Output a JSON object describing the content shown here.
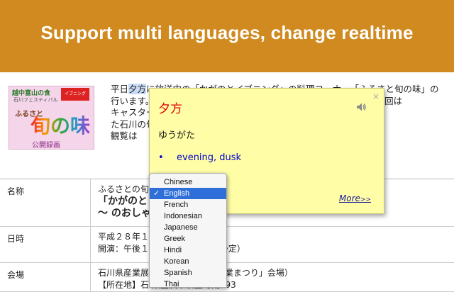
{
  "banner": {
    "title": "Support multi languages, change realtime"
  },
  "promo": {
    "line1": "越中富山の食",
    "line2": "石川フェスティバル",
    "badge": "イブニング",
    "line3": "ふるさと",
    "line4": "旬の味",
    "line5": "公開録画"
  },
  "article": {
    "line1_pre": "平日",
    "line1_highlight": "夕方",
    "line1_post": "に放送中の「かがのとイブニング」の料理コーナー「ふるさと旬の味」の",
    "line2": "行います。ふるさと旬の味が「石川の農林漁業まつり」コーナー、今回は",
    "line3": "キャスター。会場にてセット、料理人が会場を訪れ、その場で",
    "line4": "た石川の旬の食材を使って、吉祥寺の米田シェフから学",
    "line5": "観覧は"
  },
  "table": {
    "rows": [
      {
        "key": "名称",
        "v1": "ふるさとの旬",
        "v2": "「かがのと",
        "v3": "〜               のおしゃれメシ〜"
      },
      {
        "key": "日時",
        "v1": "平成２８年１",
        "v2": "開演：午後１                 午後２時３０分（予定）"
      },
      {
        "key": "会場",
        "v1": "石川県産業展              38回 石川の農林漁業まつり」会場）",
        "v2": "【所在地】石                 県金沢市袋畠町南193"
      }
    ]
  },
  "popup": {
    "word": "夕方",
    "reading": "ゆうがた",
    "bullet": "•",
    "meaning": "evening, dusk",
    "more_label": "More",
    "more_suffix": ">>",
    "close_glyph": "×"
  },
  "language_dropdown": {
    "selected": "English",
    "check_glyph": "✓",
    "options": [
      "Chinese",
      "English",
      "French",
      "Indonesian",
      "Japanese",
      "Greek",
      "Hindi",
      "Korean",
      "Spanish",
      "Thai"
    ]
  },
  "colors": {
    "banner": "#D08A20",
    "popup_bg": "#fffea6",
    "word": "#e00000",
    "selected": "#2f6fd9"
  }
}
